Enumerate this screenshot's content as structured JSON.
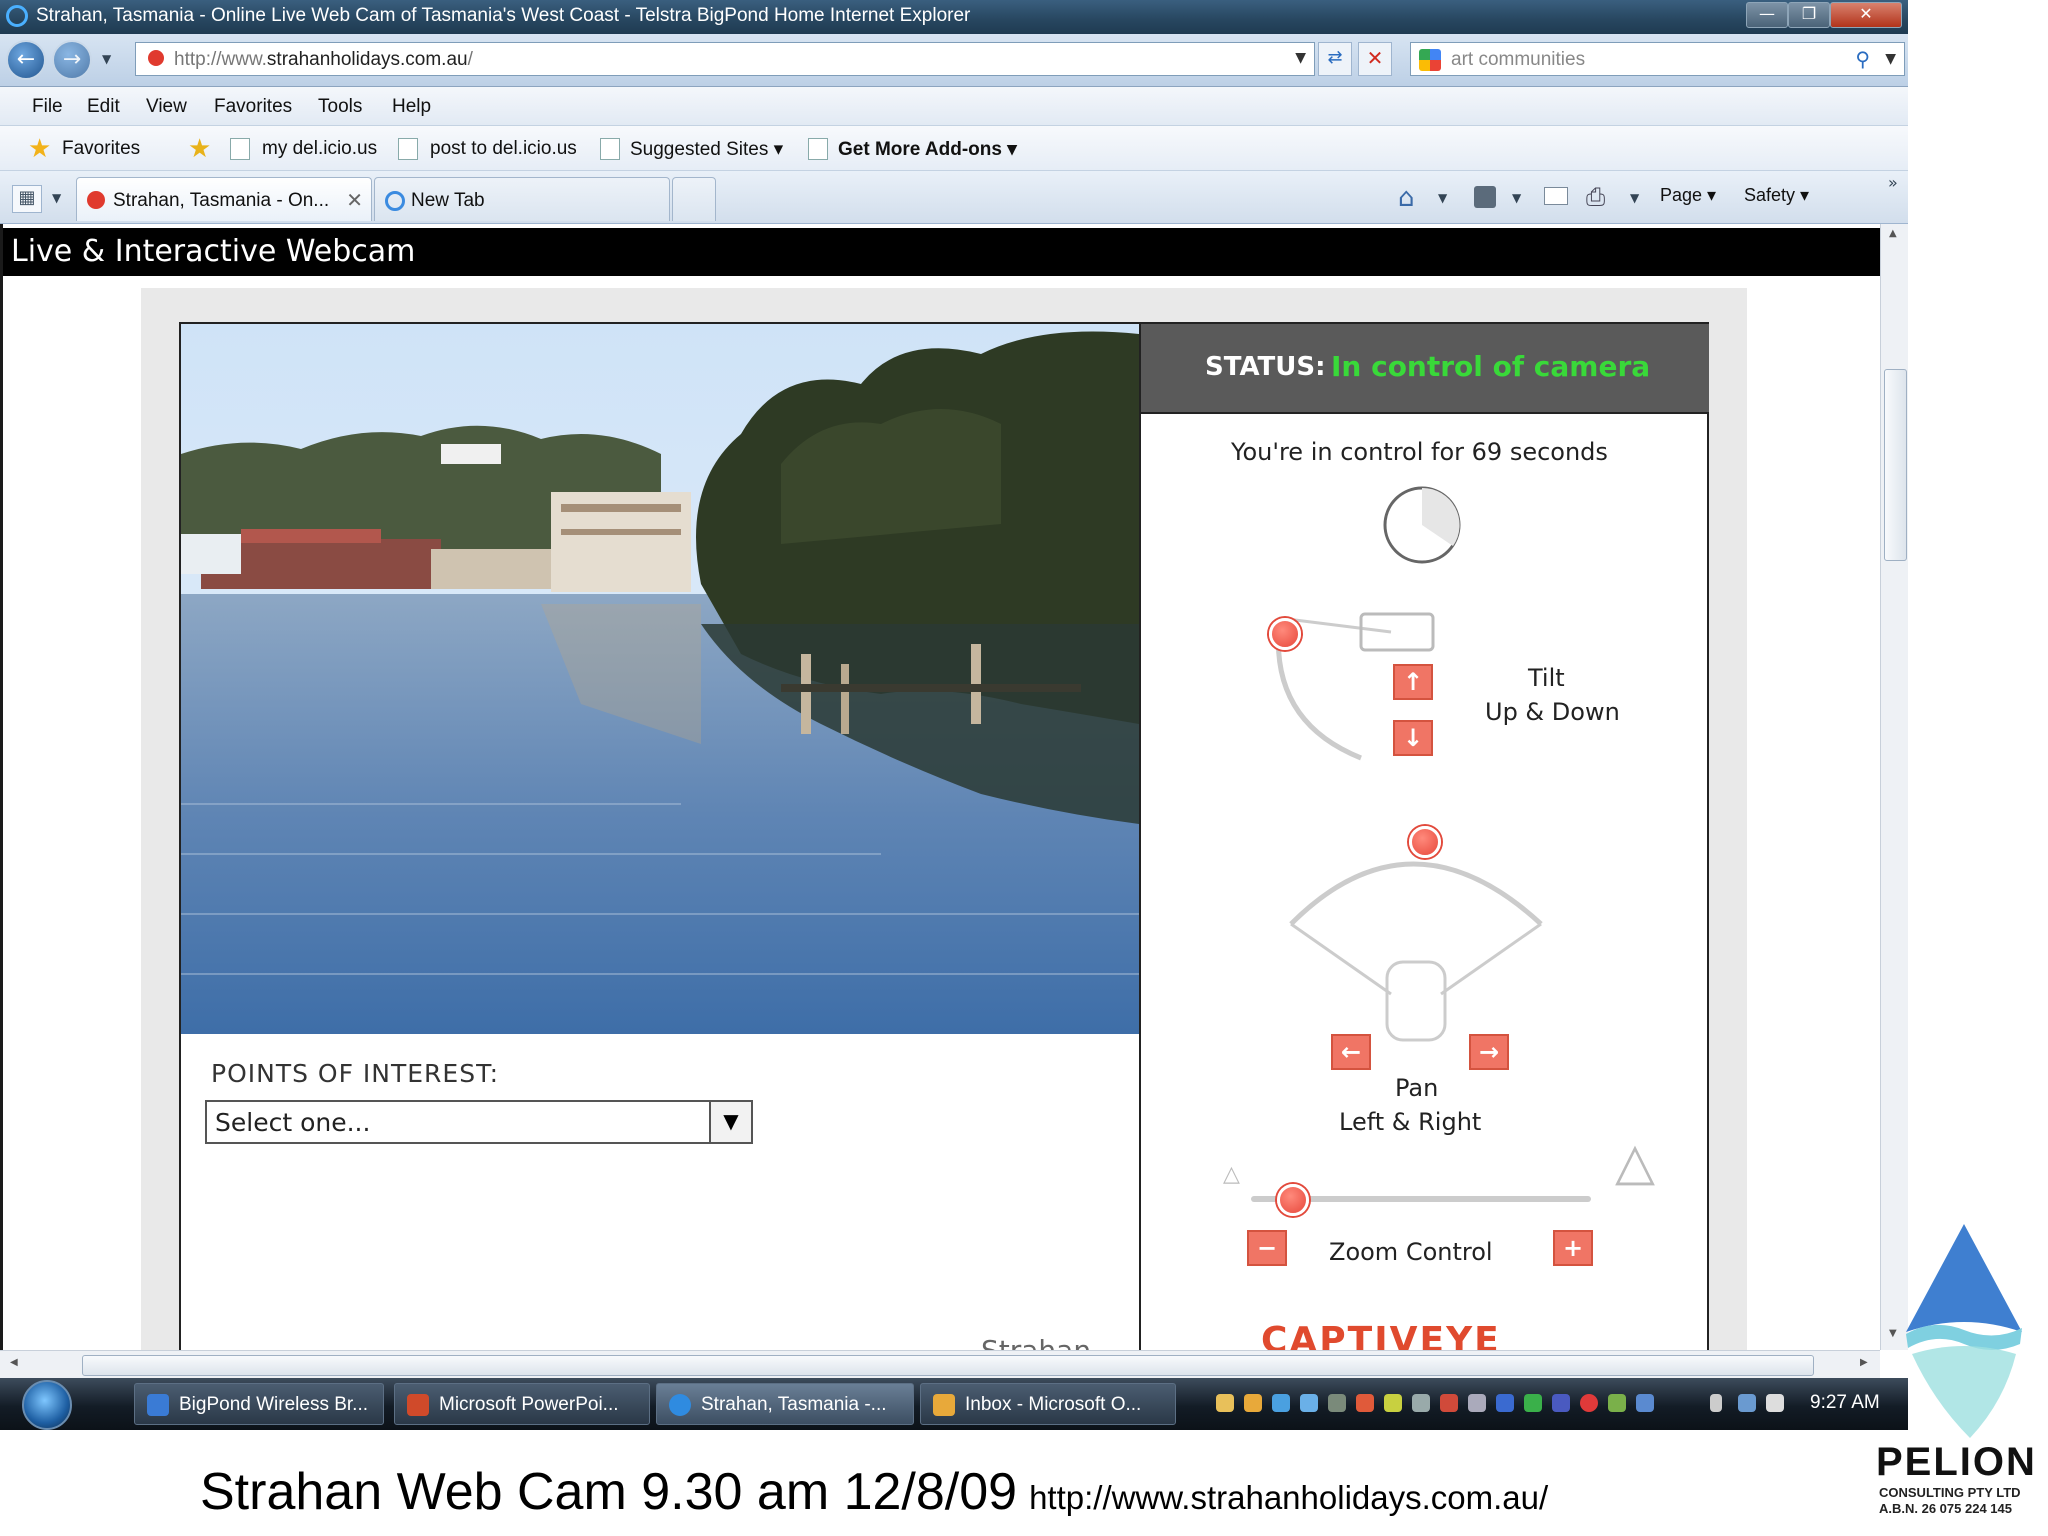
{
  "window": {
    "title": "Strahan, Tasmania - Online Live Web Cam of Tasmania's West Coast - Telstra BigPond Home Internet Explorer",
    "controls": [
      "—",
      "❐",
      "✕"
    ]
  },
  "address_bar": {
    "url_prefix": "http://www.",
    "url_domain": "strahanholidays.com.au",
    "url_suffix": "/",
    "search_value": "art communities"
  },
  "menu": [
    "File",
    "Edit",
    "View",
    "Favorites",
    "Tools",
    "Help"
  ],
  "favorites_bar": {
    "favorites_label": "Favorites",
    "items": [
      "my del.icio.us",
      "post to del.icio.us",
      "Suggested Sites ▾",
      "Get More Add-ons ▾"
    ]
  },
  "tabs": [
    {
      "label": "Strahan, Tasmania - On..."
    },
    {
      "label": "New Tab"
    }
  ],
  "command_bar": {
    "page_label": "Page ▾",
    "safety_label": "Safety ▾"
  },
  "page": {
    "header_title": "Live & Interactive Webcam",
    "status_label": "STATUS:",
    "status_value": "In control of camera",
    "control_time": "You're in control for 69 seconds",
    "tilt_label_1": "Tilt",
    "tilt_label_2": "Up & Down",
    "pan_label_1": "Pan",
    "pan_label_2": "Left & Right",
    "zoom_label": "Zoom Control",
    "poi_label": "POINTS OF INTEREST:",
    "poi_selected": "Select one...",
    "bottom_partial_left": "Strahan",
    "bottom_partial_logo": "CAPTIVEYE"
  },
  "taskbar": {
    "items": [
      {
        "label": "BigPond Wireless Br...",
        "color": "#3a7bd5"
      },
      {
        "label": "Microsoft PowerPoi...",
        "color": "#d04a2a"
      },
      {
        "label": "Strahan, Tasmania -...",
        "color": "#2f8be0"
      },
      {
        "label": "Inbox - Microsoft O...",
        "color": "#e8a93a"
      }
    ],
    "clock": "9:27 AM"
  },
  "caption": {
    "main": "Strahan Web Cam 9.30 am 12/8/09",
    "url": "http://www.strahanholidays.com.au/"
  },
  "logo": {
    "name": "PELION",
    "line1": "CONSULTING PTY LTD",
    "line2": "A.B.N. 26 075 224 145"
  },
  "colors": {
    "status_green": "#39d939",
    "control_red": "#f07565",
    "header_black": "#000000"
  }
}
